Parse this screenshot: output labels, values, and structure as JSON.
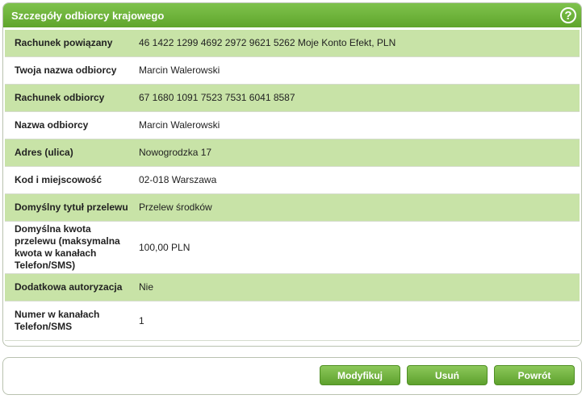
{
  "panel": {
    "title": "Szczegóły odbiorcy krajowego",
    "help_symbol": "?"
  },
  "rows": [
    {
      "label": "Rachunek powiązany",
      "value": "46 1422 1299 4692 2972 9621 5262 Moje Konto Efekt, PLN"
    },
    {
      "label": "Twoja nazwa odbiorcy",
      "value": "Marcin Walerowski"
    },
    {
      "label": "Rachunek odbiorcy",
      "value": "67 1680 1091 7523 7531 6041 8587"
    },
    {
      "label": "Nazwa odbiorcy",
      "value": "Marcin Walerowski"
    },
    {
      "label": "Adres (ulica)",
      "value": "Nowogrodzka 17"
    },
    {
      "label": "Kod i miejscowość",
      "value": "02-018 Warszawa"
    },
    {
      "label": "Domyślny tytuł przelewu",
      "value": "Przelew środków"
    },
    {
      "label": "Domyślna kwota przelewu (maksymalna kwota w kanałach Telefon/SMS)",
      "value": "100,00 PLN"
    },
    {
      "label": "Dodatkowa autoryzacja",
      "value": "Nie"
    },
    {
      "label": "Numer w kanałach Telefon/SMS",
      "value": "1"
    }
  ],
  "buttons": {
    "modify": "Modyfikuj",
    "delete": "Usuń",
    "back": "Powrót"
  },
  "colors": {
    "header_green": "#6db23a",
    "row_alt_green": "#c8e3a7",
    "button_green": "#6fae3c"
  }
}
